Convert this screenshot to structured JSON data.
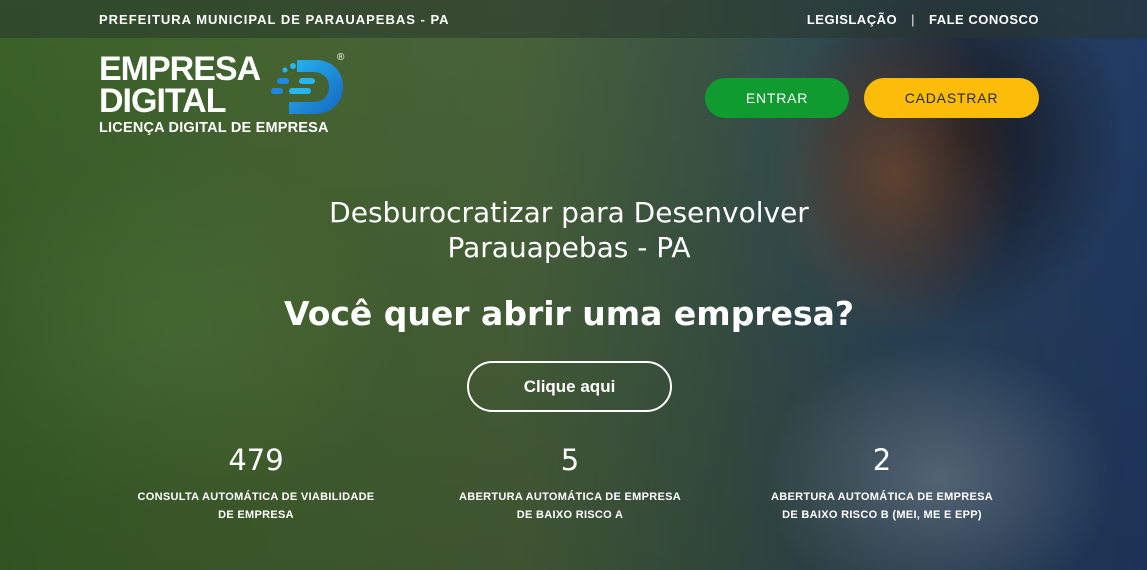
{
  "topbar": {
    "org": "PREFEITURA MUNICIPAL DE PARAUAPEBAS - PA",
    "links": [
      "LEGISLAÇÃO",
      "FALE CONOSCO"
    ],
    "separator": "|"
  },
  "logo": {
    "line1": "EMPRESA",
    "line2": "DIGITAL",
    "line3": "LICENÇA DIGITAL DE EMPRESA",
    "registered": "®",
    "icon": "d-letter-icon",
    "colors": {
      "blue": "#1e88e5",
      "cyan": "#27b6f0"
    }
  },
  "header": {
    "entrar_label": "ENTRAR",
    "cadastrar_label": "CADASTRAR"
  },
  "hero": {
    "tagline_line1": "Desburocratizar para Desenvolver",
    "tagline_line2": "Parauapebas - PA",
    "question": "Você quer abrir uma empresa?",
    "cta_label": "Clique aqui"
  },
  "stats": [
    {
      "value": "479",
      "label_line1": "CONSULTA AUTOMÁTICA DE VIABILIDADE",
      "label_line2": "DE EMPRESA"
    },
    {
      "value": "5",
      "label_line1": "ABERTURA AUTOMÁTICA DE EMPRESA",
      "label_line2": "DE BAIXO RISCO A"
    },
    {
      "value": "2",
      "label_line1": "ABERTURA AUTOMÁTICA DE EMPRESA",
      "label_line2": "DE BAIXO RISCO B (MEI, ME E EPP)"
    }
  ],
  "colors": {
    "entrar_bg": "#0f9b2f",
    "cadastrar_bg": "#fbbd07"
  }
}
